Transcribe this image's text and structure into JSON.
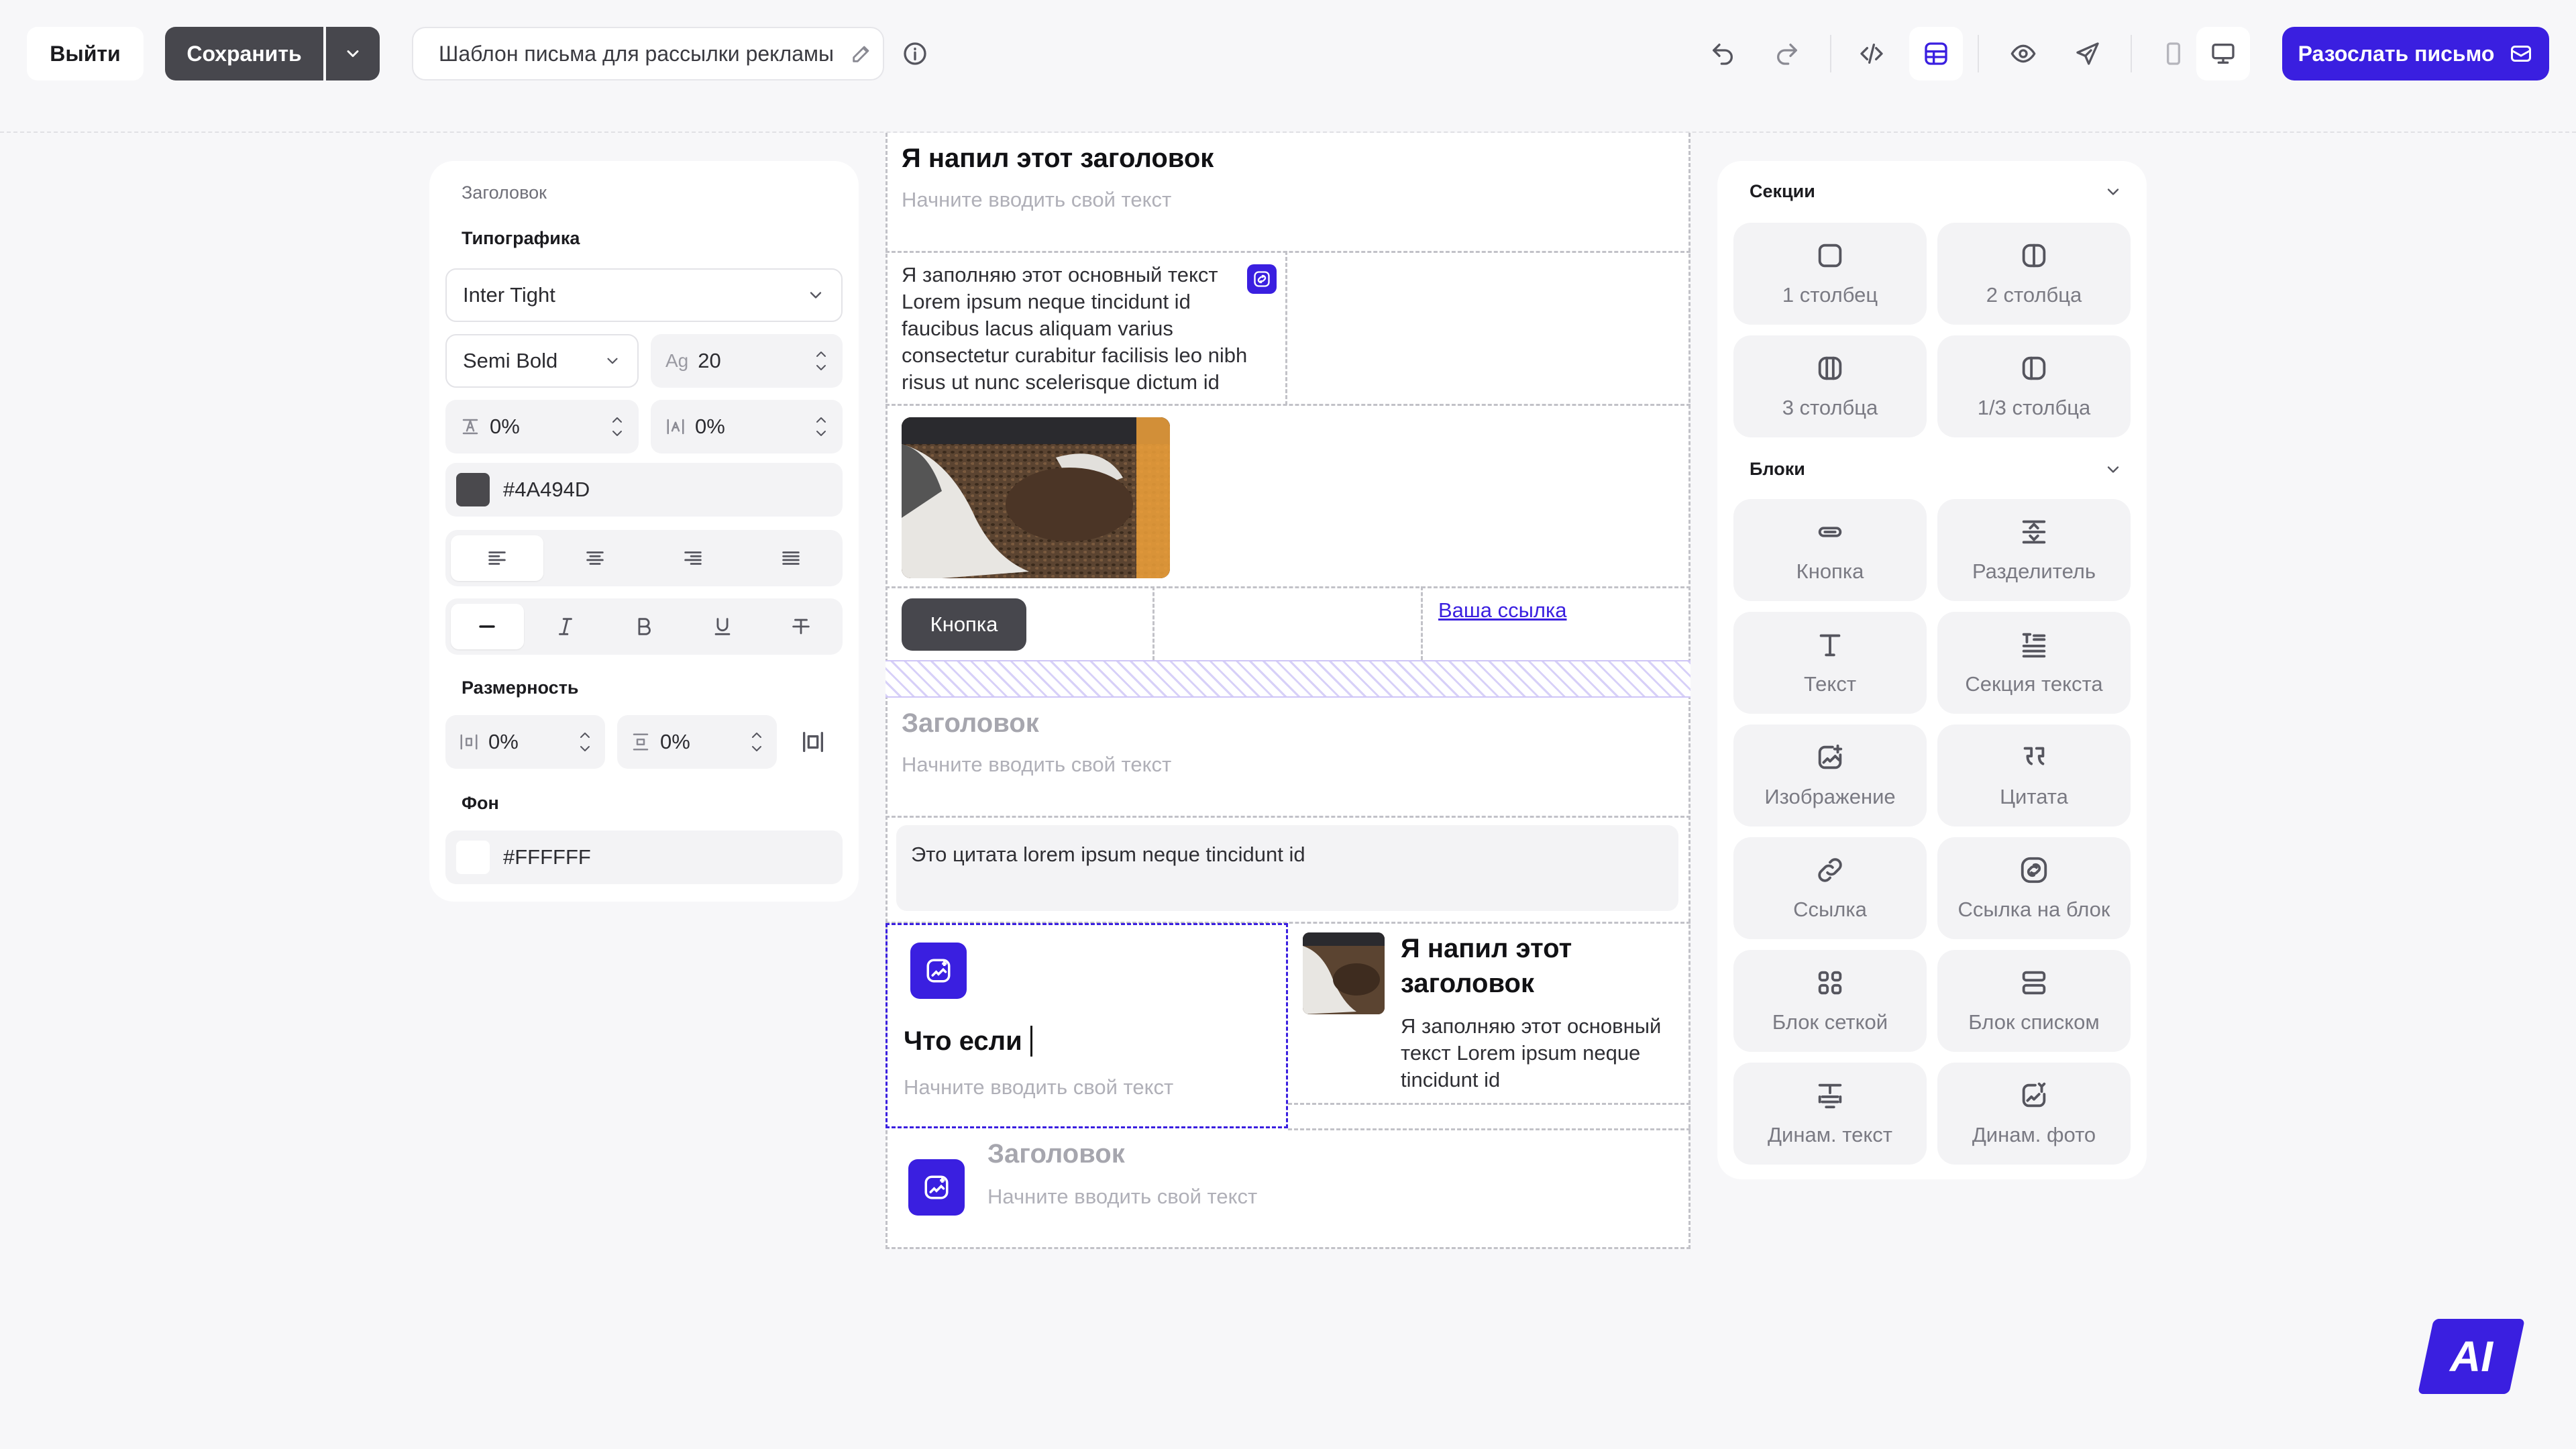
{
  "topbar": {
    "exit_label": "Выйти",
    "save_label": "Сохранить",
    "template_name": "Шаблон письма для рассылки рекламы",
    "send_label": "Разослать письмо"
  },
  "left_panel": {
    "section_label": "Заголовок",
    "typography_label": "Типографика",
    "font_family": "Inter Tight",
    "font_weight": "Semi Bold",
    "font_size_icon": "Ag",
    "font_size": "20",
    "line_height": "0%",
    "letter_spacing": "0%",
    "text_color": "#4A494D",
    "dimensions_label": "Размерность",
    "padding_h": "0%",
    "padding_v": "0%",
    "background_label": "Фон",
    "background_color": "#FFFFFF"
  },
  "canvas": {
    "block1_title": "Я напил этот заголовок",
    "block1_placeholder": "Начните вводить свой текст",
    "block2_text": "Я заполняю этот основный текст Lorem ipsum neque tincidunt id faucibus lacus aliquam varius consectetur curabitur facilisis leo nibh risus ut nunc scelerisque dictum id",
    "button_label": "Кнопка",
    "link_label": "Ваша ссылка",
    "block5_title": "Заголовок",
    "block5_placeholder": "Начните вводить свой текст",
    "quote_text": "Это цитата lorem ipsum neque tincidunt id",
    "card_left_title": "Что если",
    "card_left_placeholder": "Начните вводить свой текст",
    "card_right_title": "Я напил этот заголовок",
    "card_right_text": "Я заполняю этот основный текст Lorem ipsum neque tincidunt id",
    "block8_title": "Заголовок",
    "block8_placeholder": "Начните вводить свой текст"
  },
  "right_panel": {
    "sections_label": "Секции",
    "sections": [
      {
        "label": "1 столбец",
        "icon": "one-column-icon"
      },
      {
        "label": "2 столбца",
        "icon": "two-columns-icon"
      },
      {
        "label": "3 столбца",
        "icon": "three-columns-icon"
      },
      {
        "label": "1/3 столбца",
        "icon": "one-third-columns-icon"
      }
    ],
    "blocks_label": "Блоки",
    "blocks": [
      {
        "label": "Кнопка",
        "icon": "button-icon"
      },
      {
        "label": "Разделитель",
        "icon": "divider-icon"
      },
      {
        "label": "Текст",
        "icon": "text-icon"
      },
      {
        "label": "Секция текста",
        "icon": "text-section-icon"
      },
      {
        "label": "Изображение",
        "icon": "image-icon"
      },
      {
        "label": "Цитата",
        "icon": "quote-icon"
      },
      {
        "label": "Ссылка",
        "icon": "link-icon"
      },
      {
        "label": "Ссылка на блок",
        "icon": "block-link-icon"
      },
      {
        "label": "Блок сеткой",
        "icon": "grid-block-icon"
      },
      {
        "label": "Блок списком",
        "icon": "list-block-icon"
      },
      {
        "label": "Динам. текст",
        "icon": "dynamic-text-icon"
      },
      {
        "label": "Динам. фото",
        "icon": "dynamic-photo-icon"
      }
    ]
  },
  "ai_badge": "AI",
  "colors": {
    "accent": "#3A1FE0",
    "dark_button": "#47474D",
    "text_color_swatch": "#4A494D",
    "page_bg": "#F7F7F9"
  }
}
